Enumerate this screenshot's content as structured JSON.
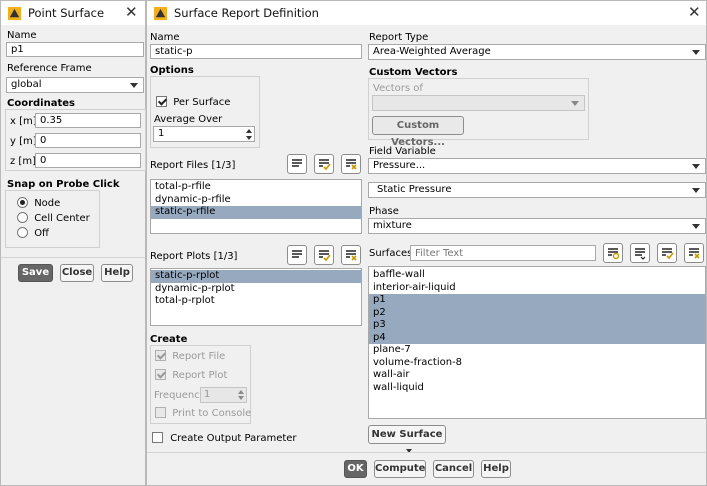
{
  "point_surface": {
    "title": "Point Surface",
    "name_label": "Name",
    "name_value": "p1",
    "ref_frame_label": "Reference Frame",
    "ref_frame_value": "global",
    "coordinates_label": "Coordinates",
    "x_label": "x [m]",
    "x_value": "0.35",
    "y_label": "y [m]",
    "y_value": "0",
    "z_label": "z [m]",
    "z_value": "0",
    "snap_label": "Snap on Probe Click",
    "snap_options": [
      "Node",
      "Cell Center",
      "Off"
    ],
    "snap_selected": "Node",
    "buttons": {
      "save": "Save",
      "close": "Close",
      "help": "Help"
    }
  },
  "report": {
    "title": "Surface Report Definition",
    "name_label": "Name",
    "name_value": "static-p",
    "options_label": "Options",
    "per_surface_label": "Per Surface",
    "per_surface_checked": true,
    "average_over_label": "Average Over",
    "average_over_value": "1",
    "report_files_label": "Report Files [1/3]",
    "report_files": [
      {
        "label": "total-p-rfile",
        "selected": false
      },
      {
        "label": "dynamic-p-rfile",
        "selected": false
      },
      {
        "label": "static-p-rfile",
        "selected": true
      }
    ],
    "report_plots_label": "Report Plots [1/3]",
    "report_plots": [
      {
        "label": "static-p-rplot",
        "selected": true
      },
      {
        "label": "dynamic-p-rplot",
        "selected": false
      },
      {
        "label": "total-p-rplot",
        "selected": false
      }
    ],
    "create_label": "Create",
    "report_file_label": "Report File",
    "report_plot_label": "Report Plot",
    "frequency_label": "Frequency",
    "frequency_value": "1",
    "print_console_label": "Print to Console",
    "create_output_label": "Create Output Parameter",
    "report_type_label": "Report Type",
    "report_type_value": "Area-Weighted Average",
    "custom_vectors_label": "Custom Vectors",
    "vectors_of_label": "Vectors of",
    "custom_vectors_button": "Custom Vectors...",
    "field_variable_label": "Field Variable",
    "field_variable_value": "Pressure...",
    "field_variable_sub": "Static Pressure",
    "phase_label": "Phase",
    "phase_value": "mixture",
    "surfaces_label": "Surfaces",
    "surfaces_filter_placeholder": "Filter Text",
    "surfaces": [
      {
        "label": "baffle-wall",
        "selected": false
      },
      {
        "label": "interior-air-liquid",
        "selected": false
      },
      {
        "label": "p1",
        "selected": true
      },
      {
        "label": "p2",
        "selected": true
      },
      {
        "label": "p3",
        "selected": true
      },
      {
        "label": "p4",
        "selected": true
      },
      {
        "label": "plane-7",
        "selected": false
      },
      {
        "label": "volume-fraction-8",
        "selected": false
      },
      {
        "label": "wall-air",
        "selected": false
      },
      {
        "label": "wall-liquid",
        "selected": false
      }
    ],
    "new_surface_button": "New Surface",
    "buttons": {
      "ok": "OK",
      "compute": "Compute",
      "cancel": "Cancel",
      "help": "Help"
    }
  }
}
